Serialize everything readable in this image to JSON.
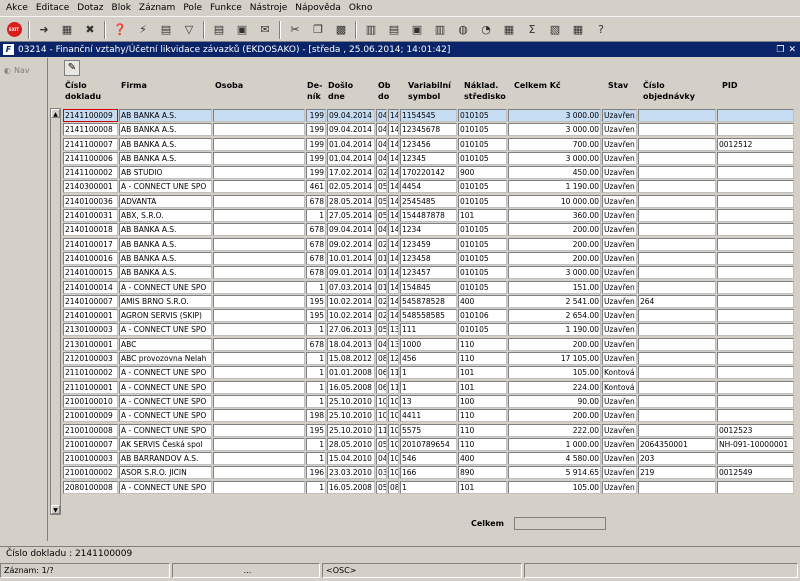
{
  "menu": [
    "Akce",
    "Editace",
    "Dotaz",
    "Blok",
    "Záznam",
    "Pole",
    "Funkce",
    "Nástroje",
    "Nápověda",
    "Okno"
  ],
  "toolbar": {
    "exit": "EXIT"
  },
  "window": {
    "title": "03214 - Finanční vztahy/Účetní likvidace závazků (EKDOSAKO) - [středa , 25.06.2014; 14:01:42]",
    "icon": "F"
  },
  "nav_label": "Nav",
  "columns": {
    "c1": "Číslo dokladu",
    "c2": "Firma",
    "c3": "Osoba",
    "c4": "De-ník",
    "c5": "Došlo dne",
    "c6": "Ob do",
    "c7": "Variabilní symbol",
    "c8": "Náklad. středisko",
    "c9": "Celkem Kč",
    "c10": "Stav",
    "c11": "Číslo objednávky",
    "c12": "PID"
  },
  "rows": [
    [
      "2141100009",
      "AB BANKA A.S.",
      "",
      "199",
      "09.04.2014",
      "04",
      "14",
      "1154545",
      "010105",
      "3 000.00",
      "Uzavřen",
      "",
      ""
    ],
    [
      "2141100008",
      "AB BANKA A.S.",
      "",
      "199",
      "09.04.2014",
      "04",
      "14",
      "12345678",
      "010105",
      "3 000.00",
      "Uzavřen",
      "",
      ""
    ],
    [
      "2141100007",
      "AB BANKA A.S.",
      "",
      "199",
      "01.04.2014",
      "04",
      "14",
      "123456",
      "010105",
      "700.00",
      "Uzavřen",
      "",
      "0012512"
    ],
    [
      "2141100006",
      "AB BANKA A.S.",
      "",
      "199",
      "01.04.2014",
      "04",
      "14",
      "12345",
      "010105",
      "3 000.00",
      "Uzavřen",
      "",
      ""
    ],
    [
      "2141100002",
      "AB STUDIO",
      "",
      "199",
      "17.02.2014",
      "02",
      "14",
      "170220142",
      "900",
      "450.00",
      "Uzavřen",
      "",
      ""
    ],
    [
      "2140300001",
      "A - CONNECT UNE SPO",
      "",
      "461",
      "02.05.2014",
      "05",
      "14",
      "4454",
      "010105",
      "1 190.00",
      "Uzavřen",
      "",
      ""
    ],
    [
      "2140100036",
      "ADVANTA",
      "",
      "678",
      "28.05.2014",
      "05",
      "14",
      "2545485",
      "010105",
      "10 000.00",
      "Uzavřen",
      "",
      ""
    ],
    [
      "2140100031",
      "ABX, S.R.O.",
      "",
      "1",
      "27.05.2014",
      "05",
      "14",
      "154487878",
      "101",
      "360.00",
      "Uzavřen",
      "",
      ""
    ],
    [
      "2140100018",
      "AB BANKA A.S.",
      "",
      "678",
      "09.04.2014",
      "04",
      "14",
      "1234",
      "010105",
      "200.00",
      "Uzavřen",
      "",
      ""
    ],
    [
      "2140100017",
      "AB BANKA A.S.",
      "",
      "678",
      "09.02.2014",
      "02",
      "14",
      "123459",
      "010105",
      "200.00",
      "Uzavřen",
      "",
      ""
    ],
    [
      "2140100016",
      "AB BANKA A.S.",
      "",
      "678",
      "10.01.2014",
      "01",
      "14",
      "123458",
      "010105",
      "200.00",
      "Uzavřen",
      "",
      ""
    ],
    [
      "2140100015",
      "AB BANKA A.S.",
      "",
      "678",
      "09.01.2014",
      "01",
      "14",
      "123457",
      "010105",
      "3 000.00",
      "Uzavřen",
      "",
      ""
    ],
    [
      "2140100014",
      "A - CONNECT UNE SPO",
      "",
      "1",
      "07.03.2014",
      "01",
      "14",
      "154845",
      "010105",
      "151.00",
      "Uzavřen",
      "",
      ""
    ],
    [
      "2140100007",
      "AMIS BRNO S.R.O.",
      "",
      "195",
      "10.02.2014",
      "02",
      "14",
      "545878528",
      "400",
      "2 541.00",
      "Uzavřen",
      "264",
      ""
    ],
    [
      "2140100001",
      "AGRON SERVIS (SKIP)",
      "",
      "195",
      "10.02.2014",
      "02",
      "14",
      "548558585",
      "010106",
      "2 654.00",
      "Uzavřen",
      "",
      ""
    ],
    [
      "2130100003",
      "A - CONNECT UNE SPO",
      "",
      "1",
      "27.06.2013",
      "05",
      "13",
      "111",
      "010105",
      "1 190.00",
      "Uzavřen",
      "",
      ""
    ],
    [
      "2130100001",
      "ABC",
      "",
      "678",
      "18.04.2013",
      "04",
      "13",
      "1000",
      "110",
      "200.00",
      "Uzavřen",
      "",
      ""
    ],
    [
      "2120100003",
      "ABC provozovna Nelah",
      "",
      "1",
      "15.08.2012",
      "08",
      "12",
      "456",
      "110",
      "17 105.00",
      "Uzavřen",
      "",
      ""
    ],
    [
      "2110100002",
      "A - CONNECT UNE SPO",
      "",
      "1",
      "01.01.2008",
      "06",
      "11",
      "1",
      "101",
      "105.00",
      "Kontová",
      "",
      ""
    ],
    [
      "2110100001",
      "A - CONNECT UNE SPO",
      "",
      "1",
      "16.05.2008",
      "06",
      "11",
      "1",
      "101",
      "224.00",
      "Kontová",
      "",
      ""
    ],
    [
      "2100100010",
      "A - CONNECT UNE SPO",
      "",
      "1",
      "25.10.2010",
      "10",
      "10",
      "13",
      "100",
      "90.00",
      "Uzavřen",
      "",
      ""
    ],
    [
      "2100100009",
      "A - CONNECT UNE SPO",
      "",
      "198",
      "25.10.2010",
      "10",
      "10",
      "4411",
      "110",
      "200.00",
      "Uzavřen",
      "",
      ""
    ],
    [
      "2100100008",
      "A - CONNECT UNE SPO",
      "",
      "195",
      "25.10.2010",
      "11",
      "10",
      "5575",
      "110",
      "222.00",
      "Uzavřen",
      "",
      "0012523"
    ],
    [
      "2100100007",
      "AK SERVIS Česká spol",
      "",
      "1",
      "28.05.2010",
      "05",
      "10",
      "2010789654",
      "110",
      "1 000.00",
      "Uzavřen",
      "2064350001",
      "NH-091-10000001"
    ],
    [
      "2100100003",
      "AB BARRANDOV A.S.",
      "",
      "1",
      "15.04.2010",
      "04",
      "10",
      "546",
      "400",
      "4 580.00",
      "Uzavřen",
      "203",
      ""
    ],
    [
      "2100100002",
      "ASOR S.R.O. JICIN",
      "",
      "196",
      "23.03.2010",
      "03",
      "10",
      "166",
      "890",
      "5 914.65",
      "Uzavřen",
      "219",
      "0012549"
    ],
    [
      "2080100008",
      "A - CONNECT UNE SPO",
      "",
      "1",
      "16.05.2008",
      "05",
      "08",
      "1",
      "101",
      "105.00",
      "Uzavřen",
      "",
      ""
    ]
  ],
  "footer": {
    "celkem_label": "Celkem"
  },
  "status": {
    "line": "Číslo dokladu : 2141100009",
    "record": "Záznam: 1/?",
    "seg2": "...",
    "seg3": "<OSC>"
  }
}
